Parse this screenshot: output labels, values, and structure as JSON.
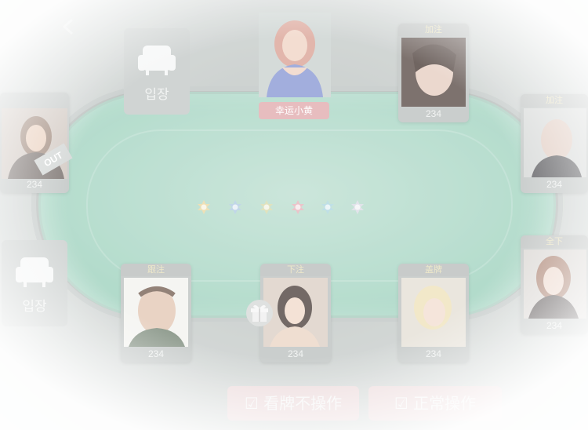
{
  "table": {
    "dealer": {
      "name": "幸运小黄"
    },
    "chips": [
      {
        "color": "#e8d59a"
      },
      {
        "color": "#a9c6df"
      },
      {
        "color": "#d5d7a6"
      },
      {
        "color": "#e4aeb6"
      },
      {
        "color": "#a7d3dd"
      },
      {
        "color": "#d6d8e2"
      }
    ]
  },
  "seats": {
    "top_right": {
      "tag": "加注",
      "chips": "234"
    },
    "right_upper": {
      "tag": "加注",
      "chips": "234"
    },
    "right_lower": {
      "tag": "全下",
      "chips": "234"
    },
    "bottom_right": {
      "tag": "盖牌",
      "chips": "234"
    },
    "bottom_center": {
      "tag": "下注",
      "chips": "234"
    },
    "bottom_left": {
      "tag": "跟注",
      "chips": "234"
    },
    "left_upper": {
      "chips": "234",
      "status": "OUT"
    },
    "empty_top_left": {
      "label": "입장"
    },
    "empty_left": {
      "label": "입장"
    }
  },
  "actions": {
    "left_button": "看牌不操作",
    "right_button": "正常操作"
  }
}
